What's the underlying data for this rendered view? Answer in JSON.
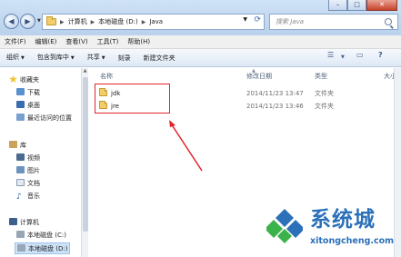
{
  "window": {
    "controls": [
      "–",
      "□",
      "✕"
    ]
  },
  "address": {
    "segments": [
      "计算机",
      "本地磁盘 (D:)",
      "Java"
    ],
    "separator": "▶"
  },
  "search": {
    "placeholder": "搜索 Java"
  },
  "menu": [
    "文件(F)",
    "编辑(E)",
    "查看(V)",
    "工具(T)",
    "帮助(H)"
  ],
  "toolbar": {
    "organize": "组织",
    "include_in_library": "包含到库中",
    "share": "共享",
    "burn": "刻录",
    "new_folder": "新建文件夹"
  },
  "nav": {
    "favorites": "收藏夹",
    "downloads": "下载",
    "desktop": "桌面",
    "recent": "最近访问的位置",
    "libraries": "库",
    "videos": "视频",
    "pictures": "图片",
    "documents": "文档",
    "music": "音乐",
    "computer": "计算机",
    "drive_c": "本地磁盘 (C:)",
    "drive_d": "本地磁盘 (D:)"
  },
  "columns": {
    "name": "名称",
    "modified": "修改日期",
    "type": "类型",
    "size": "大小"
  },
  "files": [
    {
      "name": "jdk",
      "modified": "2014/11/23 13:47",
      "type": "文件夹"
    },
    {
      "name": "jre",
      "modified": "2014/11/23 13:46",
      "type": "文件夹"
    }
  ],
  "watermark": {
    "title": "系统城",
    "url": "xitongcheng.com",
    "colors": {
      "blue": "#2b70b8",
      "green": "#3bb34a"
    }
  },
  "colors": {
    "highlight": "#e0242a"
  }
}
